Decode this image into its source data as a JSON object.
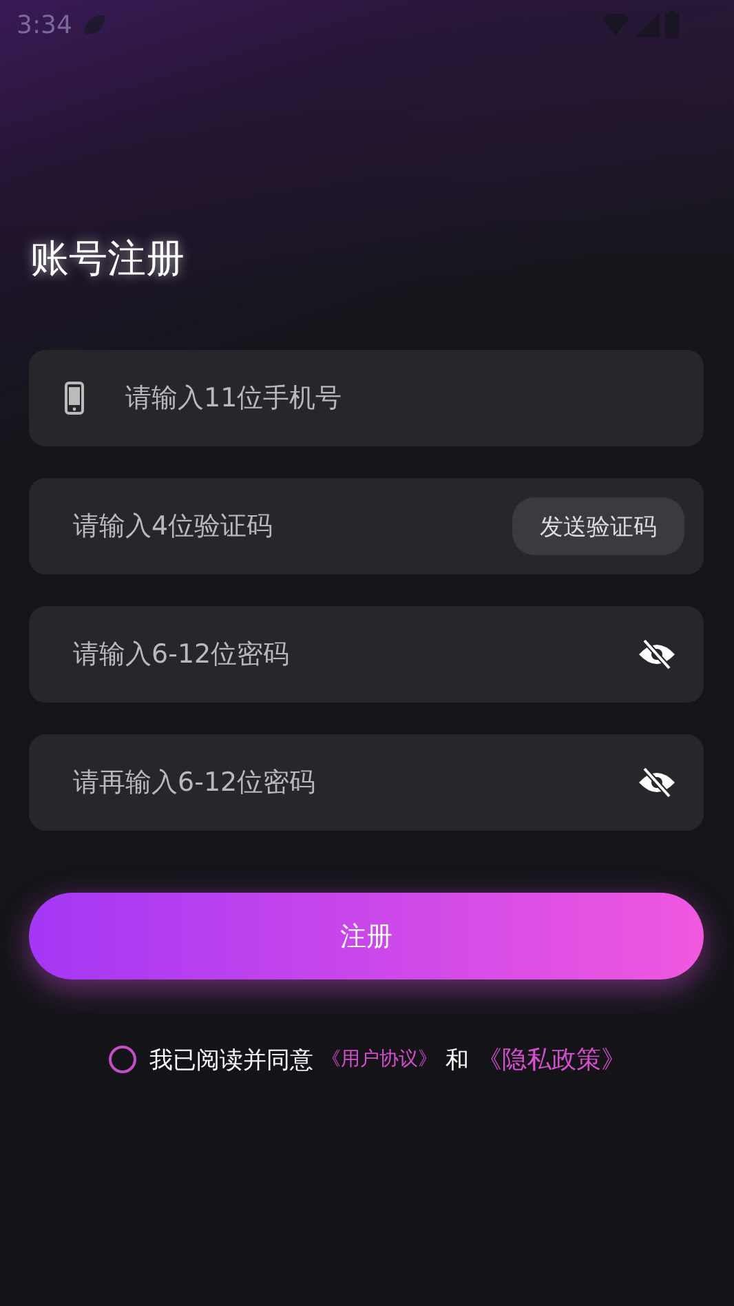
{
  "status_bar": {
    "time": "3:34"
  },
  "title": "账号注册",
  "fields": [
    {
      "kind": "phone",
      "placeholder": "请输入11位手机号"
    },
    {
      "kind": "code",
      "placeholder": "请输入4位验证码",
      "button": "发送验证码"
    },
    {
      "kind": "password",
      "placeholder": "请输入6-12位密码",
      "masked": true
    },
    {
      "kind": "password",
      "placeholder": "请再输入6-12位密码",
      "masked": true
    }
  ],
  "submit": "注册",
  "agreement": {
    "checked": false,
    "parts": [
      {
        "kind": "text",
        "text": "我已阅读并同意"
      },
      {
        "kind": "link",
        "text": "《用户协议》"
      },
      {
        "kind": "text",
        "text": "和"
      },
      {
        "kind": "link",
        "text": "《隐私政策》"
      }
    ]
  }
}
